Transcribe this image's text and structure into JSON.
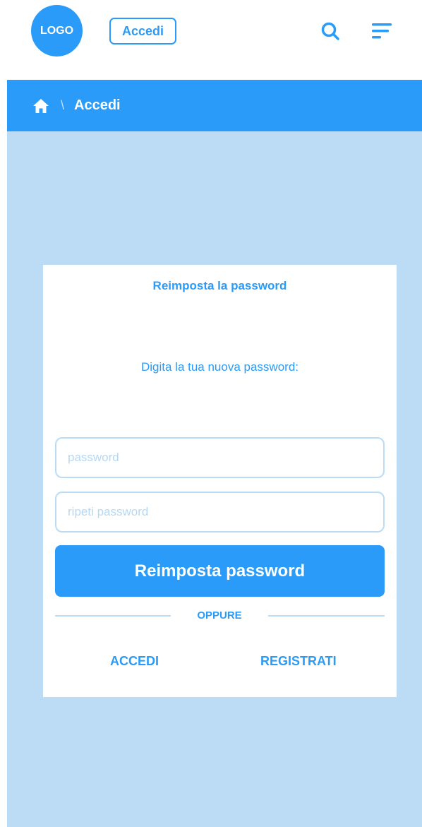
{
  "header": {
    "logo_text": "LOGO",
    "login_label": "Accedi",
    "search_icon": "search-icon",
    "menu_icon": "hamburger-menu-icon"
  },
  "breadcrumb": {
    "home_icon": "home-icon",
    "separator": "\\",
    "current": "Accedi"
  },
  "card": {
    "title": "Reimposta la password",
    "subtitle": "Digita la tua nuova password:",
    "password_placeholder": "password",
    "password_value": "",
    "repeat_placeholder": "ripeti password",
    "repeat_value": "",
    "submit_label": "Reimposta password",
    "divider_text": "OPPURE",
    "login_link": "ACCEDI",
    "register_link": "REGISTRATI"
  },
  "colors": {
    "accent": "#2a9bf8",
    "background": "#bbdcf4",
    "card": "#ffffff"
  }
}
